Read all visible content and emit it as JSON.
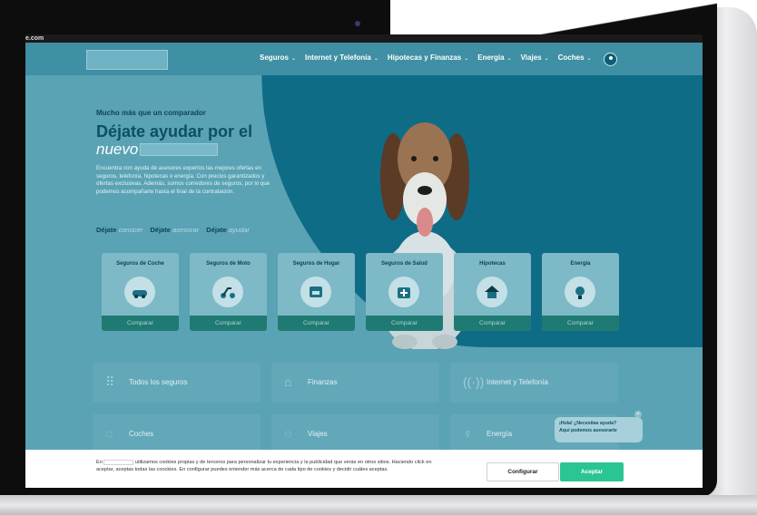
{
  "browser": {
    "url_fragment": "e.com"
  },
  "nav": {
    "items": [
      {
        "label": "Seguros"
      },
      {
        "label": "Internet y Telefonía"
      },
      {
        "label": "Hipotecas y Finanzas"
      },
      {
        "label": "Energía"
      },
      {
        "label": "Viajes"
      },
      {
        "label": "Coches"
      }
    ]
  },
  "hero": {
    "eyebrow": "Mucho más que un comparador",
    "title_line1": "Déjate ayudar por el",
    "title_line2": "nuevo",
    "description": "Encuentra con ayuda de asesores expertos las mejores ofertas en seguros, telefonía, hipotecas o energía. Con precios garantizados y ofertas exclusivas. Además, somos corredores de seguros, por lo que podemos acompañarte hasta el final de la contratación.",
    "dejate": [
      {
        "prefix": "Déjate",
        "word": "conocer"
      },
      {
        "prefix": "Déjate",
        "word": "asesorar"
      },
      {
        "prefix": "Déjate",
        "word": "ayudar"
      }
    ]
  },
  "cards": [
    {
      "label": "Seguros de Coche",
      "button": "Comparar",
      "icon": "car-icon"
    },
    {
      "label": "Seguros de Moto",
      "button": "Comparar",
      "icon": "scooter-icon"
    },
    {
      "label": "Seguros de Hogar",
      "button": "Comparar",
      "icon": "sofa-icon"
    },
    {
      "label": "Seguros de Salud",
      "button": "Comparar",
      "icon": "medical-kit-icon"
    },
    {
      "label": "Hipotecas",
      "button": "Comparar",
      "icon": "house-icon"
    },
    {
      "label": "Energía",
      "button": "Comparar",
      "icon": "lightbulb-icon"
    }
  ],
  "categories": [
    {
      "label": "Todos los seguros",
      "icon": "grid-icon"
    },
    {
      "label": "Finanzas",
      "icon": "house-outline-icon"
    },
    {
      "label": "Internet y Telefonía",
      "icon": "wifi-icon"
    },
    {
      "label": "Coches",
      "icon": "car-outline-icon"
    },
    {
      "label": "Viajes",
      "icon": "globe-icon"
    },
    {
      "label": "Energía",
      "icon": "bulb-outline-icon"
    }
  ],
  "chat": {
    "line1": "¡Hola! ¿Necesitas ayuda?",
    "line2": "Aquí podemos asesorarte",
    "close": "×"
  },
  "cookie": {
    "prefix": "En",
    "text": "utilizamos cookies propias y de terceros para personalizar tu experiencia y la publicidad que verás en otros sitios. Haciendo click en aceptar, aceptas todas las coockies. En configurar puedes entender más acerca de cada tipo de cookies y decidir cuáles aceptas.",
    "configure": "Configurar",
    "accept": "Aceptar"
  },
  "colors": {
    "accent_dark": "#0e6c86",
    "accept_green": "#2bc593"
  }
}
